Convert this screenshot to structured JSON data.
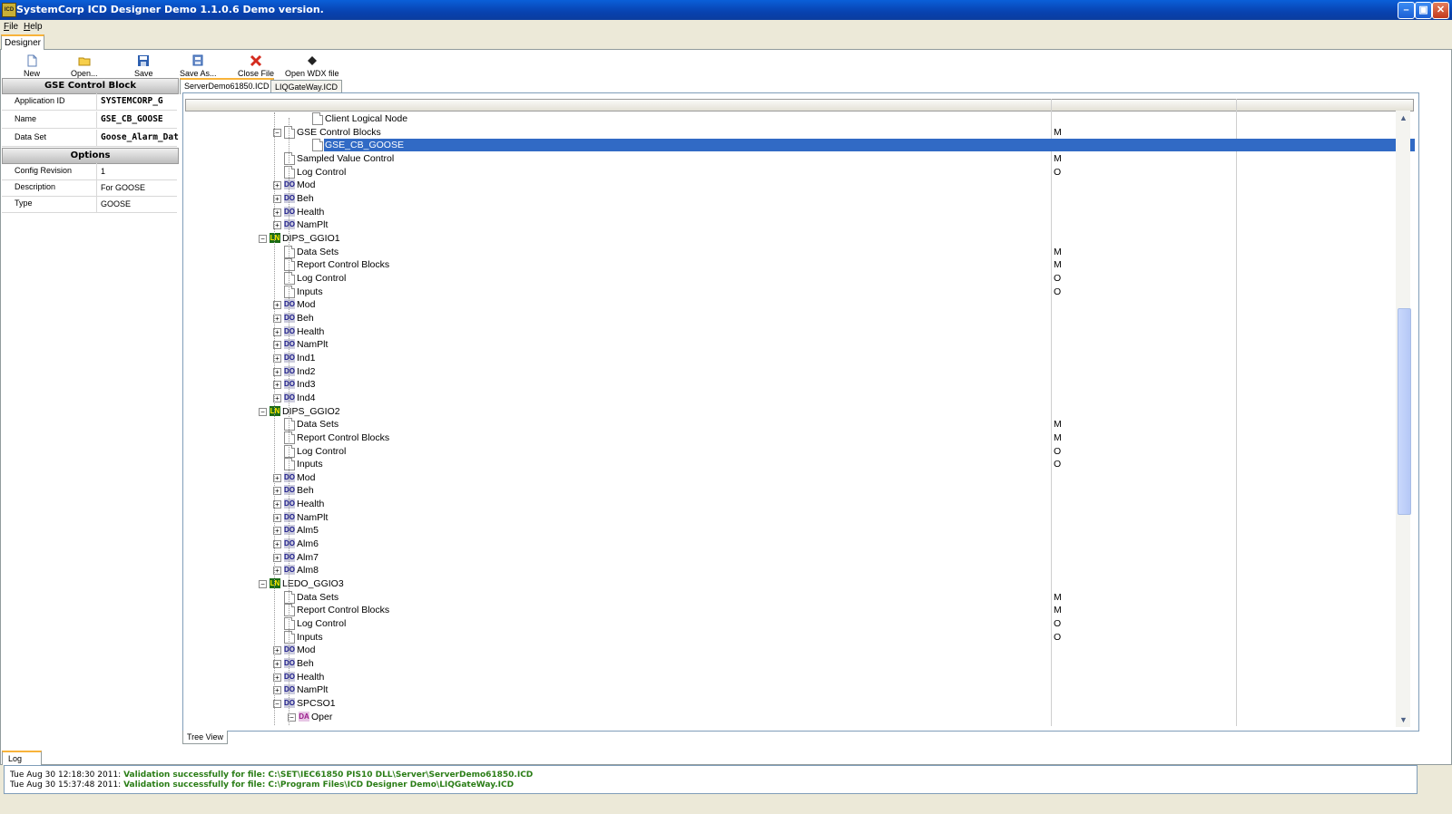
{
  "window": {
    "title": "SystemCorp ICD Designer Demo 1.1.0.6 Demo version.",
    "icon_text": "ICD"
  },
  "menu": [
    {
      "label": "File",
      "u": "F",
      "rest": "ile"
    },
    {
      "label": "Help",
      "u": "H",
      "rest": "elp"
    }
  ],
  "main_tab": "Designer",
  "toolbar": [
    "New",
    "Open...",
    "Save",
    "Save As...",
    "Close File",
    "Open WDX file"
  ],
  "properties": {
    "header1": "GSE Control Block",
    "rows1": [
      {
        "key": "Application ID",
        "value": "SYSTEMCORP_G"
      },
      {
        "key": "Name",
        "value": "GSE_CB_GOOSE"
      },
      {
        "key": "Data Set",
        "value": "Goose_Alarm_Dat"
      }
    ],
    "header2": "Options",
    "rows2": [
      {
        "key": "Config Revision",
        "value": "1"
      },
      {
        "key": "Description",
        "value": "For GOOSE"
      },
      {
        "key": "Type",
        "value": "GOOSE"
      }
    ]
  },
  "doc_tabs": [
    "ServerDemo61850.ICD",
    "LIQGateWay.ICD"
  ],
  "tree_rows": [
    {
      "label": "Client Logical Node",
      "type": "page",
      "m": ""
    },
    {
      "label": "GSE Control Blocks",
      "type": "page",
      "m": "M",
      "toggle": "-"
    },
    {
      "label": "GSE_CB_GOOSE",
      "type": "page",
      "m": "",
      "selected": true
    },
    {
      "label": "Sampled Value Control",
      "type": "page",
      "m": "M"
    },
    {
      "label": "Log Control",
      "type": "page",
      "m": "O"
    },
    {
      "label": "Mod",
      "type": "DO",
      "m": ""
    },
    {
      "label": "Beh",
      "type": "DO",
      "m": ""
    },
    {
      "label": "Health",
      "type": "DO",
      "m": ""
    },
    {
      "label": "NamPlt",
      "type": "DO",
      "m": ""
    },
    {
      "label": "DIPS_GGIO1",
      "type": "LN",
      "m": ""
    },
    {
      "label": "Data Sets",
      "type": "page",
      "m": "M"
    },
    {
      "label": "Report Control Blocks",
      "type": "page",
      "m": "M"
    },
    {
      "label": "Log Control",
      "type": "page",
      "m": "O"
    },
    {
      "label": "Inputs",
      "type": "page",
      "m": "O"
    },
    {
      "label": "Mod",
      "type": "DO",
      "m": ""
    },
    {
      "label": "Beh",
      "type": "DO",
      "m": ""
    },
    {
      "label": "Health",
      "type": "DO",
      "m": ""
    },
    {
      "label": "NamPlt",
      "type": "DO",
      "m": ""
    },
    {
      "label": "Ind1",
      "type": "DO",
      "m": ""
    },
    {
      "label": "Ind2",
      "type": "DO",
      "m": ""
    },
    {
      "label": "Ind3",
      "type": "DO",
      "m": ""
    },
    {
      "label": "Ind4",
      "type": "DO",
      "m": ""
    },
    {
      "label": "DIPS_GGIO2",
      "type": "LN",
      "m": ""
    },
    {
      "label": "Data Sets",
      "type": "page",
      "m": "M"
    },
    {
      "label": "Report Control Blocks",
      "type": "page",
      "m": "M"
    },
    {
      "label": "Log Control",
      "type": "page",
      "m": "O"
    },
    {
      "label": "Inputs",
      "type": "page",
      "m": "O"
    },
    {
      "label": "Mod",
      "type": "DO",
      "m": ""
    },
    {
      "label": "Beh",
      "type": "DO",
      "m": ""
    },
    {
      "label": "Health",
      "type": "DO",
      "m": ""
    },
    {
      "label": "NamPlt",
      "type": "DO",
      "m": ""
    },
    {
      "label": "Alm5",
      "type": "DO",
      "m": ""
    },
    {
      "label": "Alm6",
      "type": "DO",
      "m": ""
    },
    {
      "label": "Alm7",
      "type": "DO",
      "m": ""
    },
    {
      "label": "Alm8",
      "type": "DO",
      "m": ""
    },
    {
      "label": "LEDO_GGIO3",
      "type": "LN",
      "m": ""
    },
    {
      "label": "Data Sets",
      "type": "page",
      "m": "M"
    },
    {
      "label": "Report Control Blocks",
      "type": "page",
      "m": "M"
    },
    {
      "label": "Log Control",
      "type": "page",
      "m": "O"
    },
    {
      "label": "Inputs",
      "type": "page",
      "m": "O"
    },
    {
      "label": "Mod",
      "type": "DO",
      "m": ""
    },
    {
      "label": "Beh",
      "type": "DO",
      "m": ""
    },
    {
      "label": "Health",
      "type": "DO",
      "m": ""
    },
    {
      "label": "NamPlt",
      "type": "DO",
      "m": ""
    },
    {
      "label": "SPCSO1",
      "type": "DO",
      "m": "",
      "toggle": "-"
    },
    {
      "label": "Oper",
      "type": "DA",
      "m": "",
      "toggle": "-"
    }
  ],
  "bottom_tab": "Tree View",
  "log_tab": "Log",
  "log": [
    {
      "time": "Tue Aug 30 12:18:30 2011:",
      "msg": "Validation successfully for file: C:\\SET\\IEC61850 PIS10 DLL\\Server\\ServerDemo61850.ICD"
    },
    {
      "time": "Tue Aug 30 15:37:48 2011:",
      "msg": "Validation successfully for file: C:\\Program Files\\ICD Designer Demo\\LIQGateWay.ICD"
    }
  ]
}
